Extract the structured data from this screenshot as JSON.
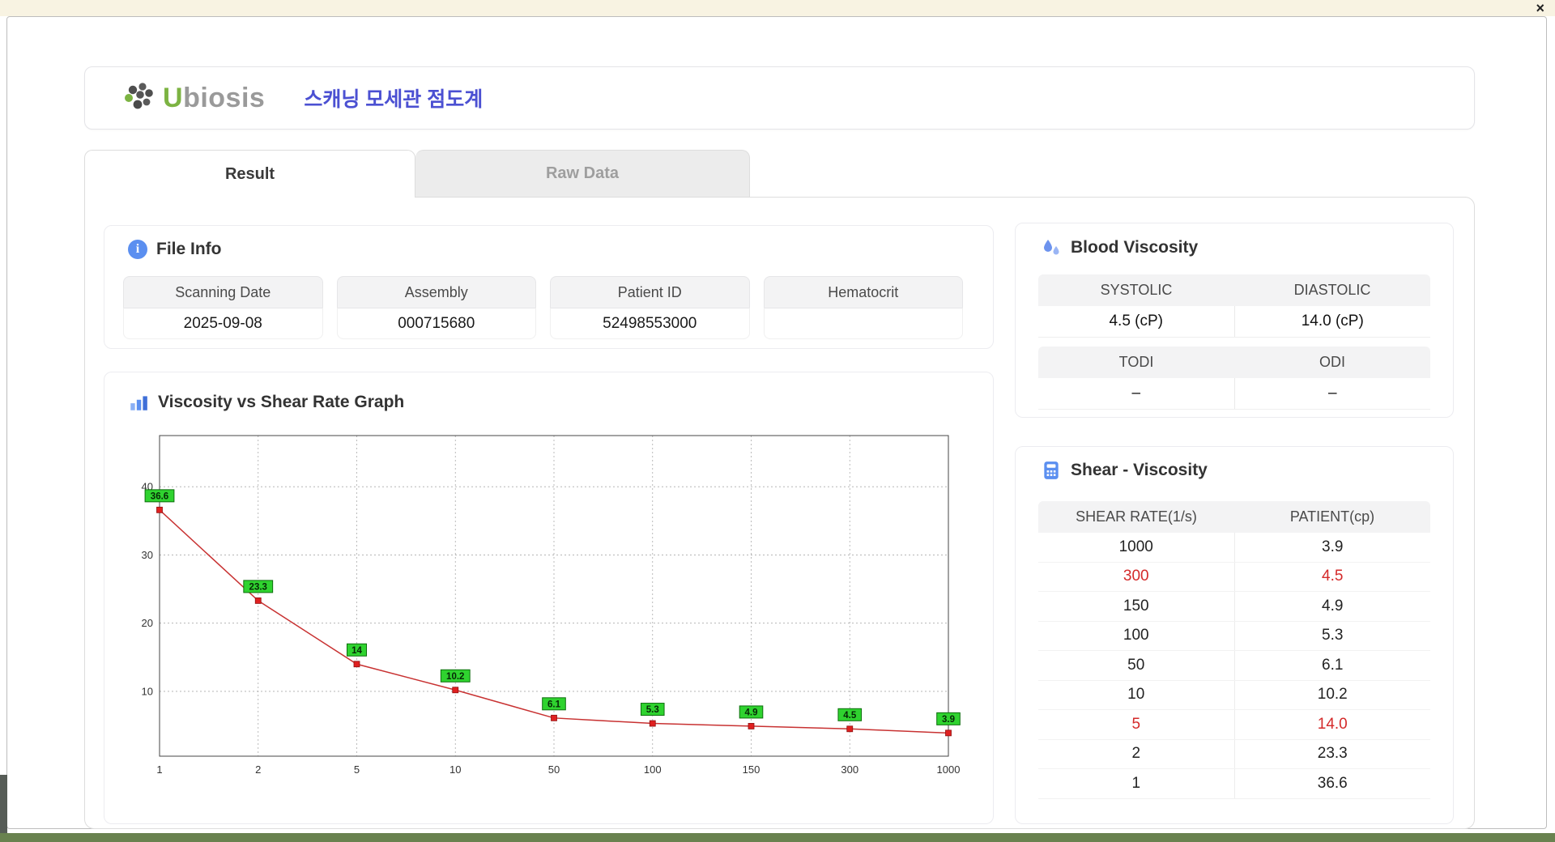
{
  "window": {
    "close_label": "×"
  },
  "header": {
    "logo_u": "U",
    "logo_rest": "biosis",
    "app_title": "스캐닝 모세관 점도계"
  },
  "tabs": {
    "result": "Result",
    "raw_data": "Raw Data"
  },
  "file_info": {
    "title": "File Info",
    "fields": [
      {
        "label": "Scanning Date",
        "value": "2025-09-08"
      },
      {
        "label": "Assembly",
        "value": "000715680"
      },
      {
        "label": "Patient ID",
        "value": "52498553000"
      },
      {
        "label": "Hematocrit",
        "value": ""
      }
    ]
  },
  "blood_viscosity": {
    "title": "Blood Viscosity",
    "rows": [
      {
        "headers": [
          "SYSTOLIC",
          "DIASTOLIC"
        ],
        "values": [
          "4.5 (cP)",
          "14.0 (cP)"
        ]
      },
      {
        "headers": [
          "TODI",
          "ODI"
        ],
        "values": [
          "–",
          "–"
        ]
      }
    ]
  },
  "shear_viscosity": {
    "title": "Shear - Viscosity",
    "columns": [
      "SHEAR RATE(1/s)",
      "PATIENT(cp)"
    ],
    "rows": [
      {
        "shear": "1000",
        "patient": "3.9",
        "highlight": false
      },
      {
        "shear": "300",
        "patient": "4.5",
        "highlight": true
      },
      {
        "shear": "150",
        "patient": "4.9",
        "highlight": false
      },
      {
        "shear": "100",
        "patient": "5.3",
        "highlight": false
      },
      {
        "shear": "50",
        "patient": "6.1",
        "highlight": false
      },
      {
        "shear": "10",
        "patient": "10.2",
        "highlight": false
      },
      {
        "shear": "5",
        "patient": "14.0",
        "highlight": true
      },
      {
        "shear": "2",
        "patient": "23.3",
        "highlight": false
      },
      {
        "shear": "1",
        "patient": "36.6",
        "highlight": false
      }
    ]
  },
  "chart_data": {
    "type": "line",
    "title": "Viscosity vs Shear Rate Graph",
    "xlabel": "",
    "ylabel": "",
    "x": [
      1,
      2,
      5,
      10,
      50,
      100,
      150,
      300,
      1000
    ],
    "x_tick_labels": [
      "1",
      "2",
      "5",
      "10",
      "50",
      "100",
      "150",
      "300",
      "1000"
    ],
    "values": [
      36.6,
      23.3,
      14,
      10.2,
      6.1,
      5.3,
      4.9,
      4.5,
      3.9
    ],
    "point_labels": [
      "36.6",
      "23.3",
      "14",
      "10.2",
      "6.1",
      "5.3",
      "4.9",
      "4.5",
      "3.9"
    ],
    "y_ticks": [
      10,
      20,
      30,
      40
    ],
    "ylim": [
      0.5,
      47.5
    ],
    "x_spacing": "equal",
    "grid": "dashed",
    "legend": "none",
    "line_color": "#c83232",
    "marker_color": "#e02020",
    "point_label_bg": "#2fd32f"
  },
  "colors": {
    "accent_blue": "#4b50d2",
    "brand_green": "#7cb342",
    "highlight_red": "#d42a2a",
    "icon_blue": "#5b8ff0",
    "label_green": "#2fd32f",
    "line_red": "#c83232",
    "titlebar_cream": "#f8f3e2"
  }
}
